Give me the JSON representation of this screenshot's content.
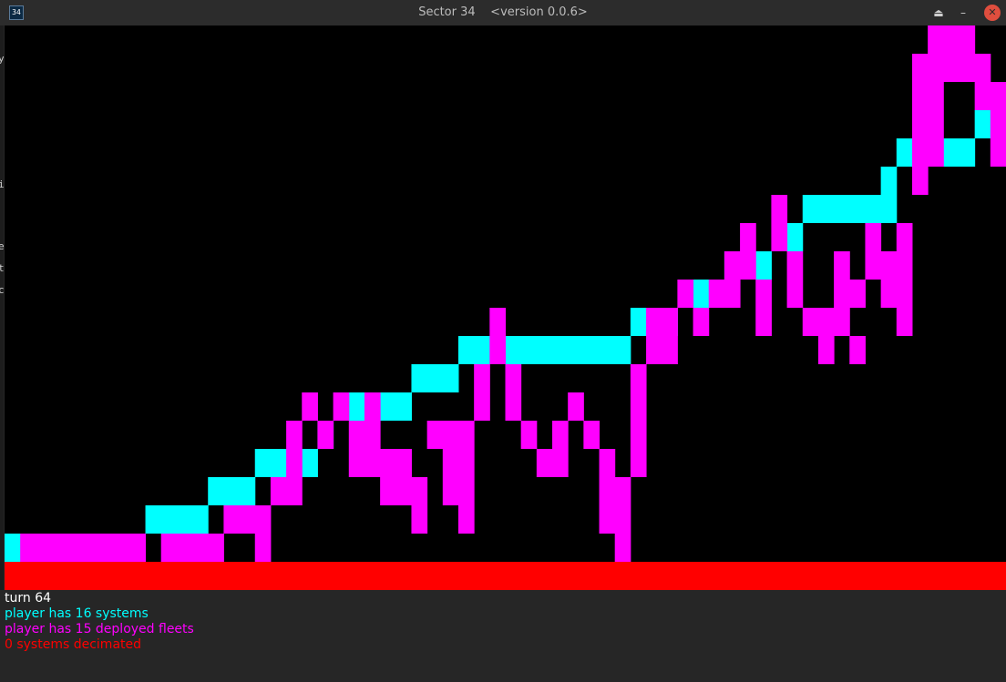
{
  "window": {
    "icon_text": "34",
    "title": "Sector 34    <version 0.0.6>",
    "buttons": [
      "eject-icon",
      "minimize-icon",
      "close-icon"
    ],
    "button_glyphs": {
      "eject": "⏏",
      "minimize": "–",
      "close": "✕"
    }
  },
  "colors": {
    "player": "#00ffff",
    "fleet": "#ff00ff",
    "decimated": "#ff0000",
    "turn_text": "#ffffff",
    "board_background": "#000000"
  },
  "board": {
    "grid_cols": 64,
    "grid_rows": 20,
    "player_cells": [
      [
        0,
        18
      ],
      [
        9,
        17
      ],
      [
        10,
        17
      ],
      [
        11,
        17
      ],
      [
        12,
        17
      ],
      [
        13,
        16
      ],
      [
        14,
        16
      ],
      [
        15,
        16
      ],
      [
        16,
        15
      ],
      [
        17,
        15
      ],
      [
        19,
        15
      ],
      [
        20,
        14
      ],
      [
        22,
        13
      ],
      [
        23,
        13
      ],
      [
        24,
        13
      ],
      [
        25,
        13
      ],
      [
        26,
        12
      ],
      [
        27,
        12
      ],
      [
        28,
        12
      ],
      [
        29,
        11
      ],
      [
        30,
        11
      ],
      [
        31,
        11
      ],
      [
        32,
        11
      ],
      [
        33,
        11
      ],
      [
        34,
        11
      ],
      [
        35,
        11
      ],
      [
        36,
        11
      ],
      [
        37,
        11
      ],
      [
        38,
        11
      ],
      [
        39,
        11
      ],
      [
        40,
        10
      ],
      [
        41,
        10
      ],
      [
        42,
        10
      ],
      [
        44,
        9
      ],
      [
        45,
        9
      ],
      [
        46,
        8
      ],
      [
        48,
        8
      ],
      [
        50,
        7
      ],
      [
        51,
        6
      ],
      [
        52,
        6
      ],
      [
        53,
        6
      ],
      [
        54,
        6
      ],
      [
        55,
        6
      ],
      [
        56,
        6
      ],
      [
        56,
        5
      ],
      [
        57,
        4
      ],
      [
        60,
        4
      ],
      [
        61,
        4
      ],
      [
        62,
        3
      ]
    ],
    "fleet_cells": [
      [
        1,
        18
      ],
      [
        2,
        18
      ],
      [
        3,
        18
      ],
      [
        4,
        18
      ],
      [
        5,
        18
      ],
      [
        6,
        18
      ],
      [
        7,
        18
      ],
      [
        8,
        18
      ],
      [
        10,
        18
      ],
      [
        11,
        18
      ],
      [
        12,
        18
      ],
      [
        13,
        18
      ],
      [
        16,
        18
      ],
      [
        39,
        18
      ],
      [
        14,
        17
      ],
      [
        15,
        17
      ],
      [
        16,
        17
      ],
      [
        26,
        17
      ],
      [
        29,
        17
      ],
      [
        38,
        17
      ],
      [
        39,
        17
      ],
      [
        17,
        16
      ],
      [
        18,
        16
      ],
      [
        24,
        16
      ],
      [
        25,
        16
      ],
      [
        26,
        16
      ],
      [
        28,
        16
      ],
      [
        29,
        16
      ],
      [
        38,
        16
      ],
      [
        39,
        16
      ],
      [
        18,
        15
      ],
      [
        22,
        15
      ],
      [
        23,
        15
      ],
      [
        24,
        15
      ],
      [
        25,
        15
      ],
      [
        28,
        15
      ],
      [
        29,
        15
      ],
      [
        34,
        15
      ],
      [
        35,
        15
      ],
      [
        38,
        15
      ],
      [
        40,
        15
      ],
      [
        18,
        14
      ],
      [
        20,
        14
      ],
      [
        22,
        14
      ],
      [
        23,
        14
      ],
      [
        27,
        14
      ],
      [
        28,
        14
      ],
      [
        29,
        14
      ],
      [
        33,
        14
      ],
      [
        35,
        14
      ],
      [
        37,
        14
      ],
      [
        40,
        14
      ],
      [
        19,
        13
      ],
      [
        21,
        13
      ],
      [
        23,
        13
      ],
      [
        30,
        13
      ],
      [
        32,
        13
      ],
      [
        36,
        13
      ],
      [
        40,
        13
      ],
      [
        30,
        12
      ],
      [
        32,
        12
      ],
      [
        40,
        12
      ],
      [
        31,
        11
      ],
      [
        31,
        10
      ],
      [
        41,
        11
      ],
      [
        42,
        11
      ],
      [
        41,
        10
      ],
      [
        52,
        11
      ],
      [
        54,
        11
      ],
      [
        42,
        10
      ],
      [
        44,
        10
      ],
      [
        48,
        10
      ],
      [
        51,
        10
      ],
      [
        52,
        10
      ],
      [
        53,
        10
      ],
      [
        57,
        10
      ],
      [
        43,
        9
      ],
      [
        45,
        9
      ],
      [
        46,
        9
      ],
      [
        48,
        9
      ],
      [
        50,
        9
      ],
      [
        53,
        9
      ],
      [
        54,
        9
      ],
      [
        56,
        9
      ],
      [
        57,
        9
      ],
      [
        46,
        8
      ],
      [
        47,
        8
      ],
      [
        50,
        8
      ],
      [
        53,
        8
      ],
      [
        55,
        8
      ],
      [
        56,
        8
      ],
      [
        57,
        8
      ],
      [
        47,
        7
      ],
      [
        49,
        7
      ],
      [
        55,
        7
      ],
      [
        57,
        7
      ],
      [
        49,
        6
      ],
      [
        58,
        5
      ],
      [
        58,
        4
      ],
      [
        59,
        4
      ],
      [
        58,
        3
      ],
      [
        59,
        3
      ],
      [
        58,
        2
      ],
      [
        59,
        2
      ],
      [
        58,
        1
      ],
      [
        59,
        1
      ],
      [
        63,
        3
      ],
      [
        63,
        4
      ],
      [
        59,
        0
      ],
      [
        60,
        0
      ],
      [
        61,
        0
      ],
      [
        60,
        1
      ],
      [
        61,
        1
      ],
      [
        62,
        1
      ],
      [
        62,
        2
      ],
      [
        63,
        2
      ]
    ],
    "decimated_band": true
  },
  "status": {
    "turn": "turn 64",
    "systems": "player has 16 systems",
    "fleets": "player has 15 deployed fleets",
    "decimated": "0 systems decimated"
  },
  "backdrop_fragments": [
    "y",
    "i",
    "t",
    "c",
    "e"
  ]
}
